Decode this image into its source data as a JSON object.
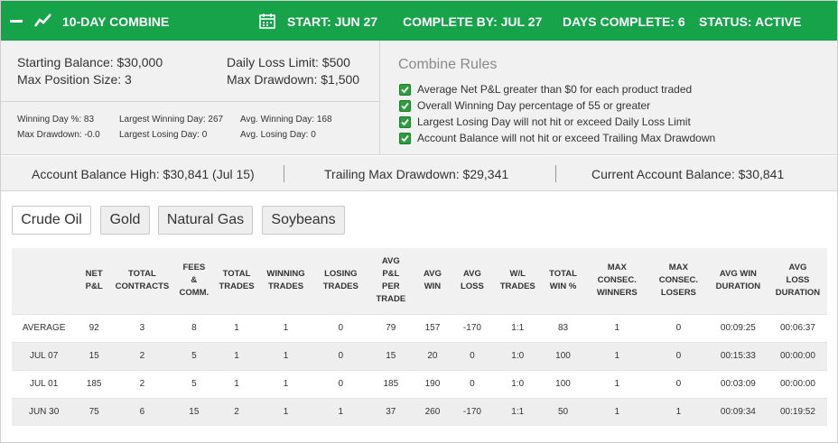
{
  "header": {
    "title": "10-DAY COMBINE",
    "start": "START: JUN 27",
    "complete_by": "COMPLETE BY: JUL 27",
    "days_complete": "DAYS COMPLETE: 6",
    "status": "STATUS: ACTIVE",
    "bg_color": "#17a34a"
  },
  "account": {
    "starting_balance": "Starting Balance: $30,000",
    "max_position_size": "Max Position Size: 3",
    "daily_loss_limit": "Daily Loss Limit: $500",
    "max_drawdown": "Max Drawdown: $1,500"
  },
  "stats": {
    "winning_day_pct": "Winning Day %: 83",
    "max_drawdown": "Max Drawdown: -0.0",
    "largest_winning_day": "Largest Winning Day: 267",
    "largest_losing_day": "Largest Losing Day: 0",
    "avg_winning_day": "Avg. Winning Day: 168",
    "avg_losing_day": "Avg. Losing Day: 0"
  },
  "rules": {
    "title": "Combine Rules",
    "items": [
      "Average Net P&L greater than $0 for each product traded",
      "Overall Winning Day percentage of 55 or greater",
      "Largest Losing Day will not hit or exceed Daily Loss Limit",
      "Account Balance will not hit or exceed Trailing Max Drawdown"
    ]
  },
  "balances": {
    "high": "Account Balance High: $30,841 (Jul 15)",
    "trailing": "Trailing Max Drawdown: $29,341",
    "current": "Current Account Balance: $30,841"
  },
  "tabs": [
    "Crude Oil",
    "Gold",
    "Natural Gas",
    "Soybeans"
  ],
  "table": {
    "headers": [
      [
        "NET",
        "P&L"
      ],
      [
        "TOTAL",
        "CONTRACTS"
      ],
      [
        "FEES",
        "&",
        "COMM."
      ],
      [
        "TOTAL",
        "TRADES"
      ],
      [
        "WINNING",
        "TRADES"
      ],
      [
        "LOSING",
        "TRADES"
      ],
      [
        "AVG",
        "P&L",
        "PER",
        "TRADE"
      ],
      [
        "AVG",
        "WIN"
      ],
      [
        "AVG",
        "LOSS"
      ],
      [
        "W/L",
        "TRADES"
      ],
      [
        "TOTAL",
        "WIN %"
      ],
      [
        "MAX",
        "CONSEC.",
        "WINNERS"
      ],
      [
        "MAX",
        "CONSEC.",
        "LOSERS"
      ],
      [
        "AVG WIN",
        "DURATION"
      ],
      [
        "AVG",
        "LOSS",
        "DURATION"
      ]
    ],
    "rows": [
      {
        "label": "AVERAGE",
        "cells": [
          "92",
          "3",
          "8",
          "1",
          "1",
          "0",
          "79",
          "157",
          "-170",
          "1:1",
          "83",
          "1",
          "0",
          "00:09:25",
          "00:06:37"
        ]
      },
      {
        "label": "JUL 07",
        "cells": [
          "15",
          "2",
          "5",
          "1",
          "1",
          "0",
          "15",
          "20",
          "0",
          "1:0",
          "100",
          "1",
          "0",
          "00:15:33",
          "00:00:00"
        ]
      },
      {
        "label": "JUL 01",
        "cells": [
          "185",
          "2",
          "5",
          "1",
          "1",
          "0",
          "185",
          "190",
          "0",
          "1:0",
          "100",
          "1",
          "0",
          "00:03:09",
          "00:00:00"
        ]
      },
      {
        "label": "JUN 30",
        "cells": [
          "75",
          "6",
          "15",
          "2",
          "1",
          "1",
          "37",
          "260",
          "-170",
          "1:1",
          "50",
          "1",
          "1",
          "00:09:34",
          "00:19:52"
        ]
      }
    ]
  }
}
